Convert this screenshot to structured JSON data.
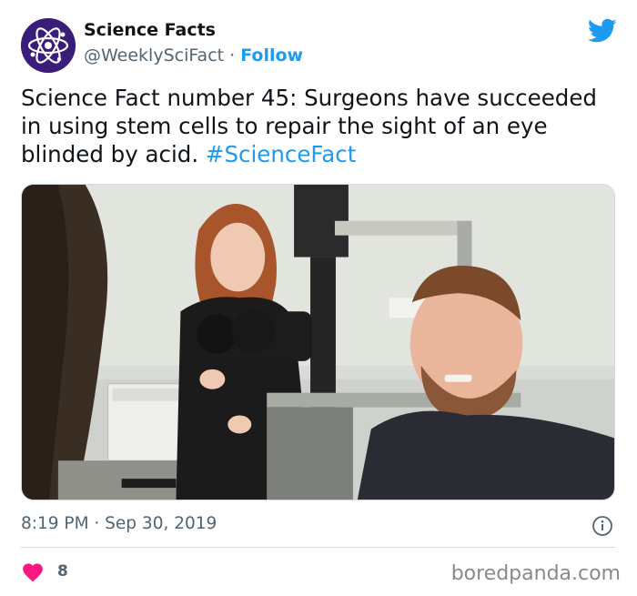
{
  "tweet": {
    "author_name": "Science Facts",
    "handle": "@WeeklySciFact",
    "separator": " · ",
    "follow_label": "Follow",
    "text_main": "Science Fact number 45:  Surgeons have succeeded in using stem cells to repair the sight of an eye blinded by acid. ",
    "hashtag": "#ScienceFact",
    "timestamp": "8:19 PM · Sep 30, 2019",
    "like_count": "8"
  },
  "icons": {
    "avatar": "atom-logo-icon",
    "brand": "twitter-bird-icon",
    "info": "info-icon",
    "like": "heart-icon"
  },
  "colors": {
    "link": "#1d9bf0",
    "heart": "#f91880",
    "avatar_bg": "#3a1d78"
  },
  "watermark": "boredpanda.com"
}
